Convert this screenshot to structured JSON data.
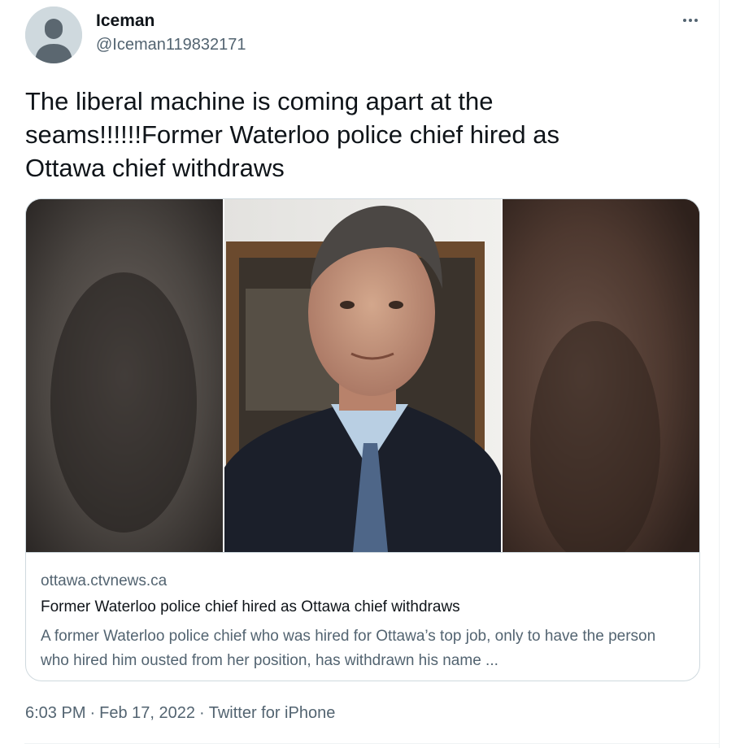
{
  "author": {
    "display_name": "Iceman",
    "handle": "@Iceman119832171",
    "avatar_icon": "default-avatar-icon"
  },
  "more_icon": "more-horizontal-icon",
  "tweet": {
    "text": "The liberal machine is coming apart at the\nseams!!!!!!Former Waterloo police chief hired as\nOttawa chief withdraws"
  },
  "card": {
    "domain": "ottawa.ctvnews.ca",
    "title": "Former Waterloo police chief hired as Ottawa chief withdraws",
    "description": "A former Waterloo police chief who was hired for Ottawa’s top job, only to have the person who hired him ousted from her position, has withdrawn his name ..."
  },
  "meta": {
    "time": "6:03 PM",
    "separator": "·",
    "date": "Feb 17, 2022",
    "source": "Twitter for iPhone"
  },
  "colors": {
    "text_primary": "#0f1419",
    "text_secondary": "#536471",
    "border": "#cfd9de"
  }
}
